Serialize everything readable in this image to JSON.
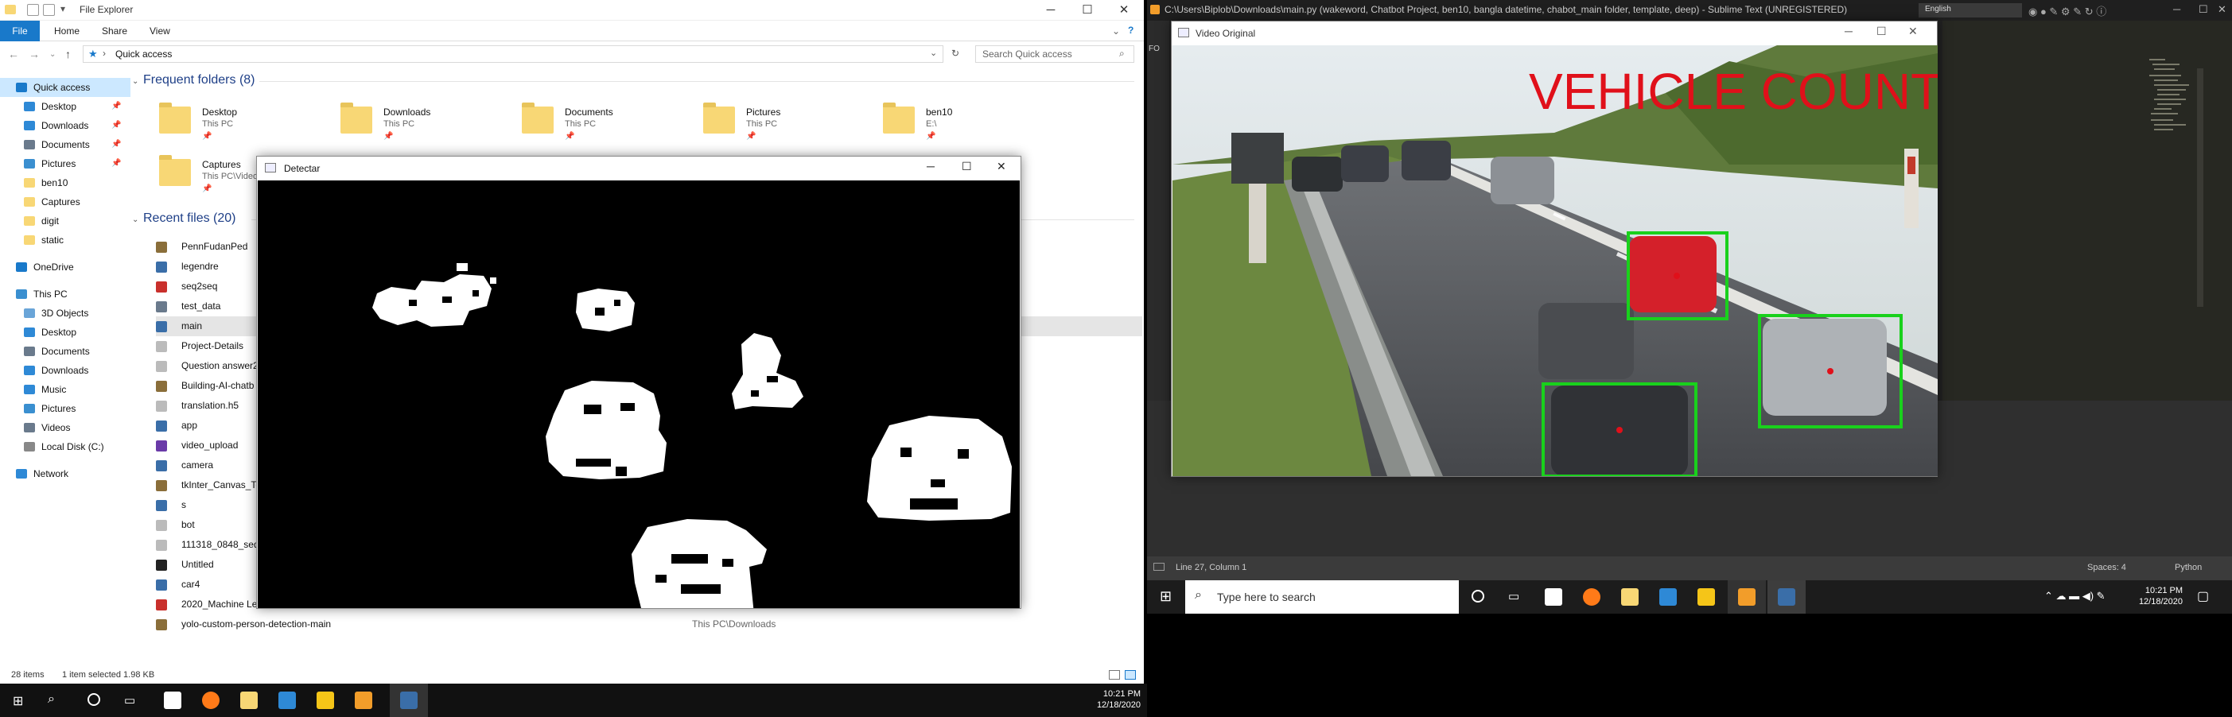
{
  "explorer": {
    "title": "File Explorer",
    "ribbon_tabs": [
      "File",
      "Home",
      "Share",
      "View"
    ],
    "address": "Quick access",
    "search_placeholder": "Search Quick access",
    "nav": [
      {
        "label": "Quick access",
        "icon": "star-icon",
        "color": "#1979ca",
        "indent": 0,
        "pinned": false,
        "selected": true
      },
      {
        "label": "Desktop",
        "icon": "desktop-icon",
        "color": "#2e89d6",
        "indent": 1,
        "pinned": true
      },
      {
        "label": "Downloads",
        "icon": "download-icon",
        "color": "#2e89d6",
        "indent": 1,
        "pinned": true
      },
      {
        "label": "Documents",
        "icon": "documents-icon",
        "color": "#6a7a8c",
        "indent": 1,
        "pinned": true
      },
      {
        "label": "Pictures",
        "icon": "pictures-icon",
        "color": "#3a8fd0",
        "indent": 1,
        "pinned": true
      },
      {
        "label": "ben10",
        "icon": "folder-icon",
        "color": "#f8d775",
        "indent": 1,
        "pinned": false
      },
      {
        "label": "Captures",
        "icon": "folder-icon",
        "color": "#f8d775",
        "indent": 1,
        "pinned": false
      },
      {
        "label": "digit",
        "icon": "folder-icon",
        "color": "#f8d775",
        "indent": 1,
        "pinned": false
      },
      {
        "label": "static",
        "icon": "folder-icon",
        "color": "#f8d775",
        "indent": 1,
        "pinned": false
      },
      {
        "label": "OneDrive",
        "icon": "cloud-icon",
        "color": "#1979ca",
        "indent": 0,
        "pinned": false
      },
      {
        "label": "This PC",
        "icon": "computer-icon",
        "color": "#3a8fd0",
        "indent": 0,
        "pinned": false
      },
      {
        "label": "3D Objects",
        "icon": "cube-icon",
        "color": "#6aa5d8",
        "indent": 1,
        "pinned": false
      },
      {
        "label": "Desktop",
        "icon": "desktop-icon",
        "color": "#2e89d6",
        "indent": 1,
        "pinned": false
      },
      {
        "label": "Documents",
        "icon": "documents-icon",
        "color": "#6a7a8c",
        "indent": 1,
        "pinned": false
      },
      {
        "label": "Downloads",
        "icon": "download-icon",
        "color": "#2e89d6",
        "indent": 1,
        "pinned": false
      },
      {
        "label": "Music",
        "icon": "music-icon",
        "color": "#2e89d6",
        "indent": 1,
        "pinned": false
      },
      {
        "label": "Pictures",
        "icon": "pictures-icon",
        "color": "#3a8fd0",
        "indent": 1,
        "pinned": false
      },
      {
        "label": "Videos",
        "icon": "videos-icon",
        "color": "#6a7a8c",
        "indent": 1,
        "pinned": false
      },
      {
        "label": "Local Disk (C:)",
        "icon": "drive-icon",
        "color": "#888888",
        "indent": 1,
        "pinned": false
      },
      {
        "label": "Network",
        "icon": "network-icon",
        "color": "#2e89d6",
        "indent": 0,
        "pinned": false
      }
    ],
    "frequent_header": "Frequent folders (8)",
    "frequent": [
      {
        "name": "Desktop",
        "loc": "This PC"
      },
      {
        "name": "Downloads",
        "loc": "This PC"
      },
      {
        "name": "Documents",
        "loc": "This PC"
      },
      {
        "name": "Pictures",
        "loc": "This PC"
      },
      {
        "name": "ben10",
        "loc": "E:\\"
      },
      {
        "name": "Captures",
        "loc": "This PC\\Videos"
      },
      {
        "name": "",
        "loc": ""
      }
    ],
    "recent_header": "Recent files (20)",
    "recent": [
      {
        "name": "PennFudanPed",
        "icon": "zip-icon",
        "color": "#8a6e3a"
      },
      {
        "name": "legendre",
        "icon": "python-icon",
        "color": "#3a6ea8"
      },
      {
        "name": "seq2seq",
        "icon": "pdf-icon",
        "color": "#c9302c"
      },
      {
        "name": "test_data",
        "icon": "image-icon",
        "color": "#6a7a8c"
      },
      {
        "name": "main",
        "icon": "python-icon",
        "color": "#3a6ea8"
      },
      {
        "name": "Project-Details",
        "icon": "document-icon",
        "color": "#bbbbbb"
      },
      {
        "name": "Question answer2",
        "icon": "document-icon",
        "color": "#bbbbbb"
      },
      {
        "name": "Building-AI-chatb",
        "icon": "zip-icon",
        "color": "#8a6e3a"
      },
      {
        "name": "translation.h5",
        "icon": "document-icon",
        "color": "#bbbbbb"
      },
      {
        "name": "app",
        "icon": "python-icon",
        "color": "#3a6ea8"
      },
      {
        "name": "video_upload",
        "icon": "video-icon",
        "color": "#6a3aa8"
      },
      {
        "name": "camera",
        "icon": "python-icon",
        "color": "#3a6ea8"
      },
      {
        "name": "tkInter_Canvas_Te",
        "icon": "zip-icon",
        "color": "#8a6e3a"
      },
      {
        "name": "s",
        "icon": "python-icon",
        "color": "#3a6ea8"
      },
      {
        "name": "bot",
        "icon": "document-icon",
        "color": "#bbbbbb"
      },
      {
        "name": "111318_0848_seq2",
        "icon": "document-icon",
        "color": "#bbbbbb"
      },
      {
        "name": "Untitled",
        "icon": "notebook-icon",
        "color": "#222222"
      },
      {
        "name": "car4",
        "icon": "python-icon",
        "color": "#3a6ea8"
      },
      {
        "name": "2020_Machine Lea",
        "icon": "pdf-icon",
        "color": "#c9302c"
      },
      {
        "name": "yolo-custom-person-detection-main",
        "icon": "zip-icon",
        "color": "#8a6e3a",
        "loc": "This PC\\Downloads"
      }
    ],
    "status": {
      "items": "28 items",
      "selected": "1 item selected  1.98 KB"
    }
  },
  "detectar": {
    "title": "Detectar"
  },
  "sublime": {
    "title": "C:\\Users\\Biplob\\Downloads\\main.py (wakeword, Chatbot Project, ben10, bangla datetime, chabot_main folder, template, deep) - Sublime Text (UNREGISTERED)",
    "side_label": "FO",
    "language_badge": "English",
    "status_left": "Line 27, Column 1",
    "status_spaces": "Spaces: 4",
    "status_syntax": "Python"
  },
  "video": {
    "title": "Video Original",
    "overlay_text": "VEHICLE  COUNT",
    "overlay_color": "#e0101a",
    "box_color": "#19d11c"
  },
  "taskbar_left": {
    "time": "10:21 PM",
    "date": "12/18/2020"
  },
  "taskbar_right": {
    "search_placeholder": "Type here to search",
    "time": "10:21 PM",
    "date": "12/18/2020"
  }
}
